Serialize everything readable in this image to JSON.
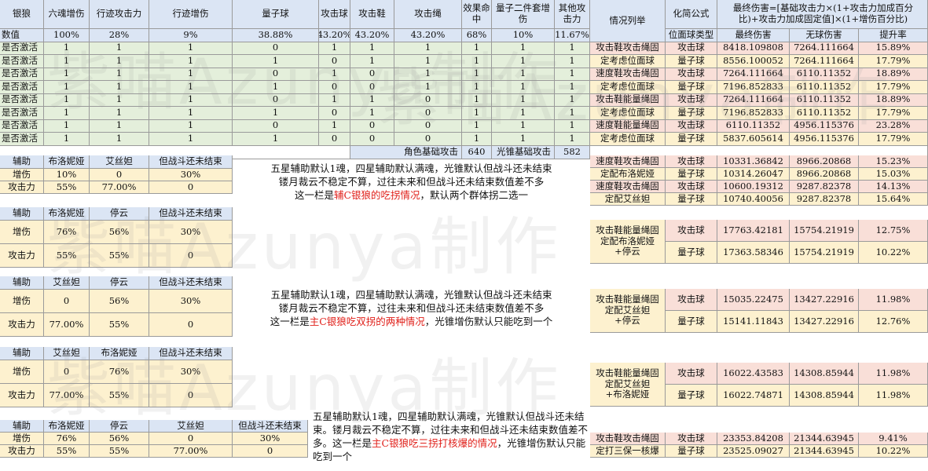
{
  "watermark": "紫喵Azunya制作",
  "top": {
    "headers": [
      "银狼",
      "六魂增伤",
      "行迹攻击力",
      "行迹增伤",
      "量子球",
      "攻击球",
      "攻击鞋",
      "攻击绳",
      "效果命中",
      "量子二件套增伤",
      "其他攻击力"
    ],
    "row_label": "数值",
    "values": [
      "100%",
      "28%",
      "9%",
      "38.88%",
      "43.20%",
      "43.20%",
      "43.20%",
      "68%",
      "10%",
      "11.67%"
    ],
    "active_label": "是否激活",
    "rows": [
      [
        "1",
        "1",
        "1",
        "0",
        "1",
        "1",
        "1",
        "1",
        "1",
        "1"
      ],
      [
        "1",
        "1",
        "1",
        "1",
        "0",
        "1",
        "1",
        "1",
        "1",
        "1"
      ],
      [
        "1",
        "1",
        "1",
        "0",
        "1",
        "0",
        "1",
        "1",
        "1",
        "1"
      ],
      [
        "1",
        "1",
        "1",
        "1",
        "0",
        "0",
        "1",
        "1",
        "1",
        "1"
      ],
      [
        "1",
        "1",
        "1",
        "0",
        "1",
        "1",
        "0",
        "1",
        "1",
        "1"
      ],
      [
        "1",
        "1",
        "1",
        "1",
        "0",
        "1",
        "0",
        "1",
        "1",
        "1"
      ],
      [
        "1",
        "1",
        "1",
        "0",
        "1",
        "0",
        "0",
        "1",
        "1",
        "1"
      ],
      [
        "1",
        "1",
        "1",
        "1",
        "0",
        "0",
        "0",
        "1",
        "1",
        "1"
      ]
    ],
    "char_atk_label": "角色基础攻击",
    "char_atk": "640",
    "lc_atk_label": "光锥基础攻击",
    "lc_atk": "582"
  },
  "right_header": {
    "scenario": "情况列举",
    "formula": "化简公式",
    "final_formula": "最终伤害=[基础攻击力×(1+攻击力加成百分比)+攻击力加成固定值]×(1+增伤百分比)",
    "cols": [
      "位面球类型",
      "最终伤害",
      "无球伤害",
      "提升率"
    ]
  },
  "results": [
    {
      "scenario": "攻击鞋攻击绳固",
      "type": "攻击球",
      "final": "8418.109808",
      "noball": "7264.111664",
      "rate": "15.89%"
    },
    {
      "scenario": "定考虑位面球",
      "type": "量子球",
      "final": "8556.100052",
      "noball": "7264.111664",
      "rate": "17.79%"
    },
    {
      "scenario": "速度鞋攻击绳固",
      "type": "攻击球",
      "final": "7264.111664",
      "noball": "6110.11352",
      "rate": "18.89%"
    },
    {
      "scenario": "定考虑位面球",
      "type": "量子球",
      "final": "7196.852833",
      "noball": "6110.11352",
      "rate": "17.79%"
    },
    {
      "scenario": "攻击鞋能量绳固",
      "type": "攻击球",
      "final": "7264.111664",
      "noball": "6110.11352",
      "rate": "18.89%"
    },
    {
      "scenario": "定考虑位面球",
      "type": "量子球",
      "final": "7196.852833",
      "noball": "6110.11352",
      "rate": "17.79%"
    },
    {
      "scenario": "速度鞋能量绳固",
      "type": "攻击球",
      "final": "6110.11352",
      "noball": "4956.115376",
      "rate": "23.28%"
    },
    {
      "scenario": "定考虑位面球",
      "type": "量子球",
      "final": "5837.605614",
      "noball": "4956.115376",
      "rate": "17.79%"
    }
  ],
  "aux1": {
    "header": [
      "辅助",
      "布洛妮娅",
      "艾丝妲",
      "但战斗还未结束"
    ],
    "rows": [
      [
        "增伤",
        "10%",
        "0",
        "30%"
      ],
      [
        "攻击力",
        "55%",
        "77.00%",
        "0"
      ]
    ],
    "note1": "五星辅助默认1魂，四星辅助默认满魂，光锥默认但战斗还未结束",
    "note2": "镂月裁云不稳定不算，过往未来和但战斗还未结束数值差不多",
    "note3a": "这一栏是",
    "note3b": "辅C银狼的吃拐情况",
    "note3c": "，默认两个群体拐二选一",
    "results": [
      {
        "scenario": "速度鞋攻击绳固",
        "type": "攻击球",
        "final": "10331.36842",
        "noball": "8966.20868",
        "rate": "15.23%"
      },
      {
        "scenario": "定配布洛妮娅",
        "type": "量子球",
        "final": "10314.26047",
        "noball": "8966.20868",
        "rate": "15.03%"
      },
      {
        "scenario": "速度鞋攻击绳固",
        "type": "攻击球",
        "final": "10600.19312",
        "noball": "9287.82378",
        "rate": "14.13%"
      },
      {
        "scenario": "定配艾丝妲",
        "type": "量子球",
        "final": "10740.40056",
        "noball": "9287.82378",
        "rate": "15.64%"
      }
    ]
  },
  "aux2": {
    "header": [
      "辅助",
      "布洛妮娅",
      "停云",
      "但战斗还未结束"
    ],
    "rows": [
      [
        "增伤",
        "76%",
        "56%",
        "30%"
      ],
      [
        "攻击力",
        "55%",
        "55%",
        "0"
      ]
    ],
    "scenario": [
      "攻击鞋能量绳固",
      "定配布洛妮娅",
      "+停云"
    ],
    "results": [
      {
        "type": "攻击球",
        "final": "17763.42181",
        "noball": "15754.21919",
        "rate": "12.75%"
      },
      {
        "type": "量子球",
        "final": "17363.58346",
        "noball": "15754.21919",
        "rate": "10.22%"
      }
    ]
  },
  "aux3": {
    "header": [
      "辅助",
      "艾丝妲",
      "停云",
      "但战斗还未结束"
    ],
    "rows": [
      [
        "增伤",
        "0",
        "56%",
        "30%"
      ],
      [
        "攻击力",
        "77.00%",
        "55%",
        "0"
      ]
    ],
    "note1": "五星辅助默认1魂，四星辅助默认满魂，光锥默认但战斗还未结束",
    "note2": "镂月裁云不稳定不算，过往未来和但战斗还未结束数值差不多",
    "note3a": "这一栏是",
    "note3b": "主C银狼吃双拐的两种情况",
    "note3c": "，光锥增伤默认只能吃到一个",
    "scenario": [
      "攻击鞋能量绳固",
      "定配艾丝妲",
      "+停云"
    ],
    "results": [
      {
        "type": "攻击球",
        "final": "15035.22475",
        "noball": "13427.22916",
        "rate": "11.98%"
      },
      {
        "type": "量子球",
        "final": "15141.11843",
        "noball": "13427.22916",
        "rate": "12.76%"
      }
    ]
  },
  "aux4": {
    "header": [
      "辅助",
      "艾丝妲",
      "布洛妮娅",
      "但战斗还未结束"
    ],
    "rows": [
      [
        "增伤",
        "0",
        "76%",
        "30%"
      ],
      [
        "攻击力",
        "77.00%",
        "55%",
        "0"
      ]
    ],
    "scenario": [
      "攻击鞋能量绳固",
      "定配艾丝妲",
      "+布洛妮娅"
    ],
    "results": [
      {
        "type": "攻击球",
        "final": "16022.43583",
        "noball": "14308.85944",
        "rate": "11.98%"
      },
      {
        "type": "量子球",
        "final": "16022.74871",
        "noball": "14308.85944",
        "rate": "11.98%"
      }
    ]
  },
  "aux5": {
    "header": [
      "辅助",
      "布洛妮娅",
      "停云",
      "艾丝妲",
      "但战斗还未结束"
    ],
    "rows": [
      [
        "增伤",
        "76%",
        "56%",
        "0",
        "30%"
      ],
      [
        "攻击力",
        "55%",
        "55%",
        "77.00%",
        "0"
      ]
    ],
    "note_a": "五星辅助默认1魂，四星辅助默认满魂，光锥默认但战斗还未结束。镂月裁云不稳定不算，过往未来和但战斗还未结束数值差不多。这一栏是",
    "note_b": "主C银狼吃三拐打核爆的情况",
    "note_c": "，光锥增伤默认只能吃到一个",
    "results": [
      {
        "scenario": "攻击鞋攻击绳固",
        "type": "攻击球",
        "final": "23353.84208",
        "noball": "21344.63945",
        "rate": "9.41%"
      },
      {
        "scenario": "定打三保一核爆",
        "type": "量子球",
        "final": "23525.09027",
        "noball": "21344.63945",
        "rate": "10.22%"
      }
    ]
  }
}
